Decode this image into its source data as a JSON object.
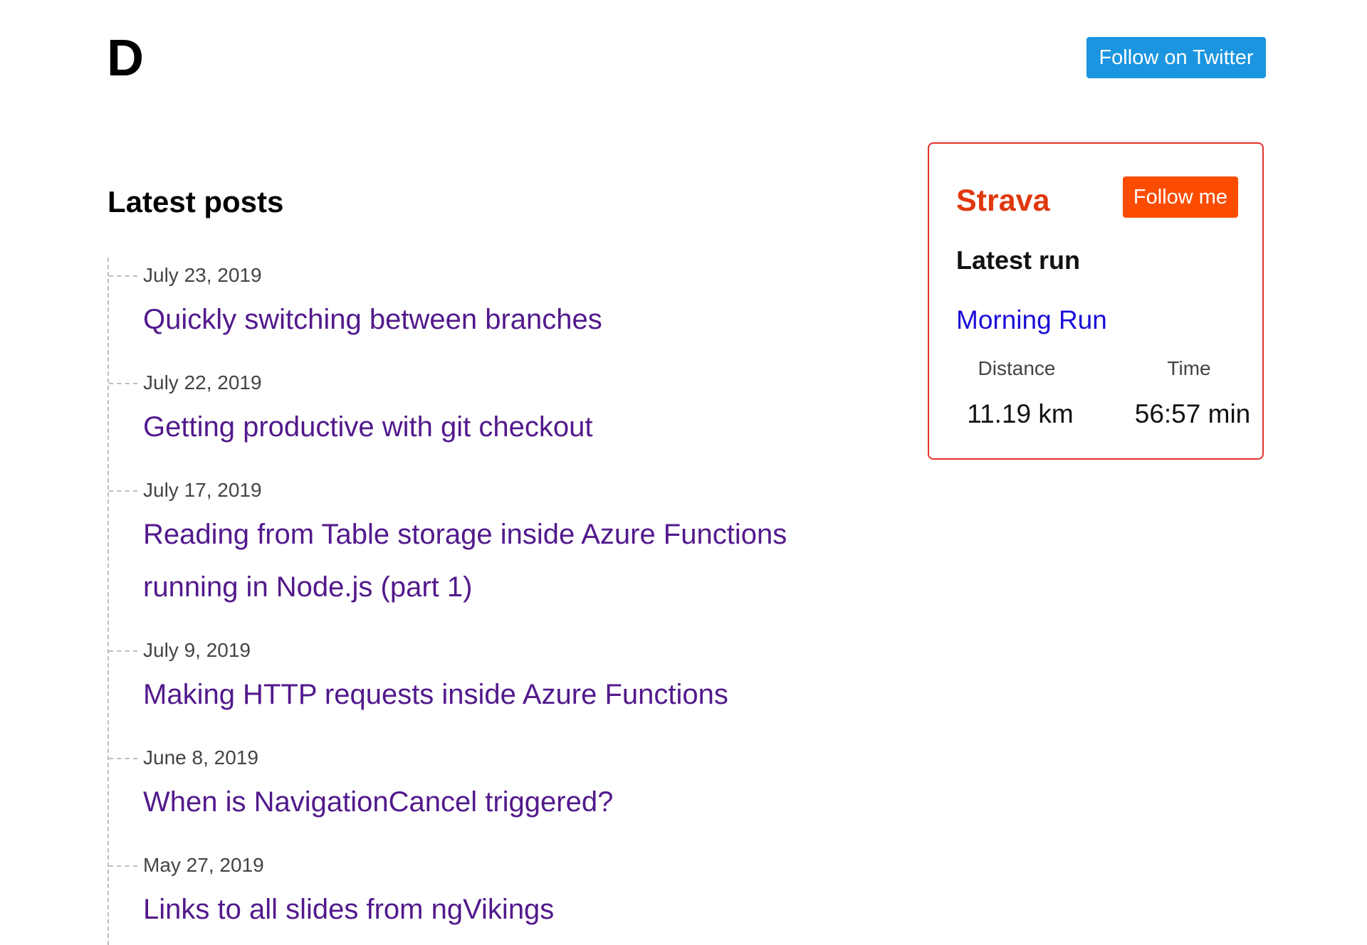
{
  "header": {
    "logo": "D",
    "twitter_button": "Follow on Twitter"
  },
  "main": {
    "section_title": "Latest posts",
    "posts": [
      {
        "date": "July 23, 2019",
        "title": "Quickly switching between branches"
      },
      {
        "date": "July 22, 2019",
        "title": "Getting productive with git checkout"
      },
      {
        "date": "July 17, 2019",
        "title": "Reading from Table storage inside Azure Functions running in Node.js (part 1)"
      },
      {
        "date": "July 9, 2019",
        "title": "Making HTTP requests inside Azure Functions"
      },
      {
        "date": "June 8, 2019",
        "title": "When is NavigationCancel triggered?"
      },
      {
        "date": "May 27, 2019",
        "title": "Links to all slides from ngVikings"
      }
    ]
  },
  "strava": {
    "title": "Strava",
    "follow_button": "Follow me",
    "latest_run_heading": "Latest run",
    "run_name": "Morning Run",
    "distance_label": "Distance",
    "time_label": "Time",
    "distance_value": "11.19 km",
    "time_value": "56:57 min"
  },
  "colors": {
    "twitter_blue": "#1b95e0",
    "strava_orange": "#fc4c02",
    "strava_border": "#e8322b",
    "post_link_visited": "#52198c",
    "run_link": "#1a0dd8"
  }
}
